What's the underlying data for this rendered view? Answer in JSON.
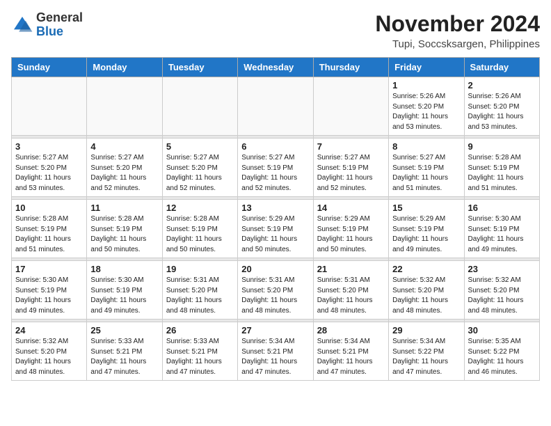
{
  "header": {
    "logo_general": "General",
    "logo_blue": "Blue",
    "month_title": "November 2024",
    "location": "Tupi, Soccsksargen, Philippines"
  },
  "days_of_week": [
    "Sunday",
    "Monday",
    "Tuesday",
    "Wednesday",
    "Thursday",
    "Friday",
    "Saturday"
  ],
  "weeks": [
    [
      {
        "day": "",
        "info": ""
      },
      {
        "day": "",
        "info": ""
      },
      {
        "day": "",
        "info": ""
      },
      {
        "day": "",
        "info": ""
      },
      {
        "day": "",
        "info": ""
      },
      {
        "day": "1",
        "info": "Sunrise: 5:26 AM\nSunset: 5:20 PM\nDaylight: 11 hours\nand 53 minutes."
      },
      {
        "day": "2",
        "info": "Sunrise: 5:26 AM\nSunset: 5:20 PM\nDaylight: 11 hours\nand 53 minutes."
      }
    ],
    [
      {
        "day": "3",
        "info": "Sunrise: 5:27 AM\nSunset: 5:20 PM\nDaylight: 11 hours\nand 53 minutes."
      },
      {
        "day": "4",
        "info": "Sunrise: 5:27 AM\nSunset: 5:20 PM\nDaylight: 11 hours\nand 52 minutes."
      },
      {
        "day": "5",
        "info": "Sunrise: 5:27 AM\nSunset: 5:20 PM\nDaylight: 11 hours\nand 52 minutes."
      },
      {
        "day": "6",
        "info": "Sunrise: 5:27 AM\nSunset: 5:19 PM\nDaylight: 11 hours\nand 52 minutes."
      },
      {
        "day": "7",
        "info": "Sunrise: 5:27 AM\nSunset: 5:19 PM\nDaylight: 11 hours\nand 52 minutes."
      },
      {
        "day": "8",
        "info": "Sunrise: 5:27 AM\nSunset: 5:19 PM\nDaylight: 11 hours\nand 51 minutes."
      },
      {
        "day": "9",
        "info": "Sunrise: 5:28 AM\nSunset: 5:19 PM\nDaylight: 11 hours\nand 51 minutes."
      }
    ],
    [
      {
        "day": "10",
        "info": "Sunrise: 5:28 AM\nSunset: 5:19 PM\nDaylight: 11 hours\nand 51 minutes."
      },
      {
        "day": "11",
        "info": "Sunrise: 5:28 AM\nSunset: 5:19 PM\nDaylight: 11 hours\nand 50 minutes."
      },
      {
        "day": "12",
        "info": "Sunrise: 5:28 AM\nSunset: 5:19 PM\nDaylight: 11 hours\nand 50 minutes."
      },
      {
        "day": "13",
        "info": "Sunrise: 5:29 AM\nSunset: 5:19 PM\nDaylight: 11 hours\nand 50 minutes."
      },
      {
        "day": "14",
        "info": "Sunrise: 5:29 AM\nSunset: 5:19 PM\nDaylight: 11 hours\nand 50 minutes."
      },
      {
        "day": "15",
        "info": "Sunrise: 5:29 AM\nSunset: 5:19 PM\nDaylight: 11 hours\nand 49 minutes."
      },
      {
        "day": "16",
        "info": "Sunrise: 5:30 AM\nSunset: 5:19 PM\nDaylight: 11 hours\nand 49 minutes."
      }
    ],
    [
      {
        "day": "17",
        "info": "Sunrise: 5:30 AM\nSunset: 5:19 PM\nDaylight: 11 hours\nand 49 minutes."
      },
      {
        "day": "18",
        "info": "Sunrise: 5:30 AM\nSunset: 5:19 PM\nDaylight: 11 hours\nand 49 minutes."
      },
      {
        "day": "19",
        "info": "Sunrise: 5:31 AM\nSunset: 5:20 PM\nDaylight: 11 hours\nand 48 minutes."
      },
      {
        "day": "20",
        "info": "Sunrise: 5:31 AM\nSunset: 5:20 PM\nDaylight: 11 hours\nand 48 minutes."
      },
      {
        "day": "21",
        "info": "Sunrise: 5:31 AM\nSunset: 5:20 PM\nDaylight: 11 hours\nand 48 minutes."
      },
      {
        "day": "22",
        "info": "Sunrise: 5:32 AM\nSunset: 5:20 PM\nDaylight: 11 hours\nand 48 minutes."
      },
      {
        "day": "23",
        "info": "Sunrise: 5:32 AM\nSunset: 5:20 PM\nDaylight: 11 hours\nand 48 minutes."
      }
    ],
    [
      {
        "day": "24",
        "info": "Sunrise: 5:32 AM\nSunset: 5:20 PM\nDaylight: 11 hours\nand 48 minutes."
      },
      {
        "day": "25",
        "info": "Sunrise: 5:33 AM\nSunset: 5:21 PM\nDaylight: 11 hours\nand 47 minutes."
      },
      {
        "day": "26",
        "info": "Sunrise: 5:33 AM\nSunset: 5:21 PM\nDaylight: 11 hours\nand 47 minutes."
      },
      {
        "day": "27",
        "info": "Sunrise: 5:34 AM\nSunset: 5:21 PM\nDaylight: 11 hours\nand 47 minutes."
      },
      {
        "day": "28",
        "info": "Sunrise: 5:34 AM\nSunset: 5:21 PM\nDaylight: 11 hours\nand 47 minutes."
      },
      {
        "day": "29",
        "info": "Sunrise: 5:34 AM\nSunset: 5:22 PM\nDaylight: 11 hours\nand 47 minutes."
      },
      {
        "day": "30",
        "info": "Sunrise: 5:35 AM\nSunset: 5:22 PM\nDaylight: 11 hours\nand 46 minutes."
      }
    ]
  ]
}
